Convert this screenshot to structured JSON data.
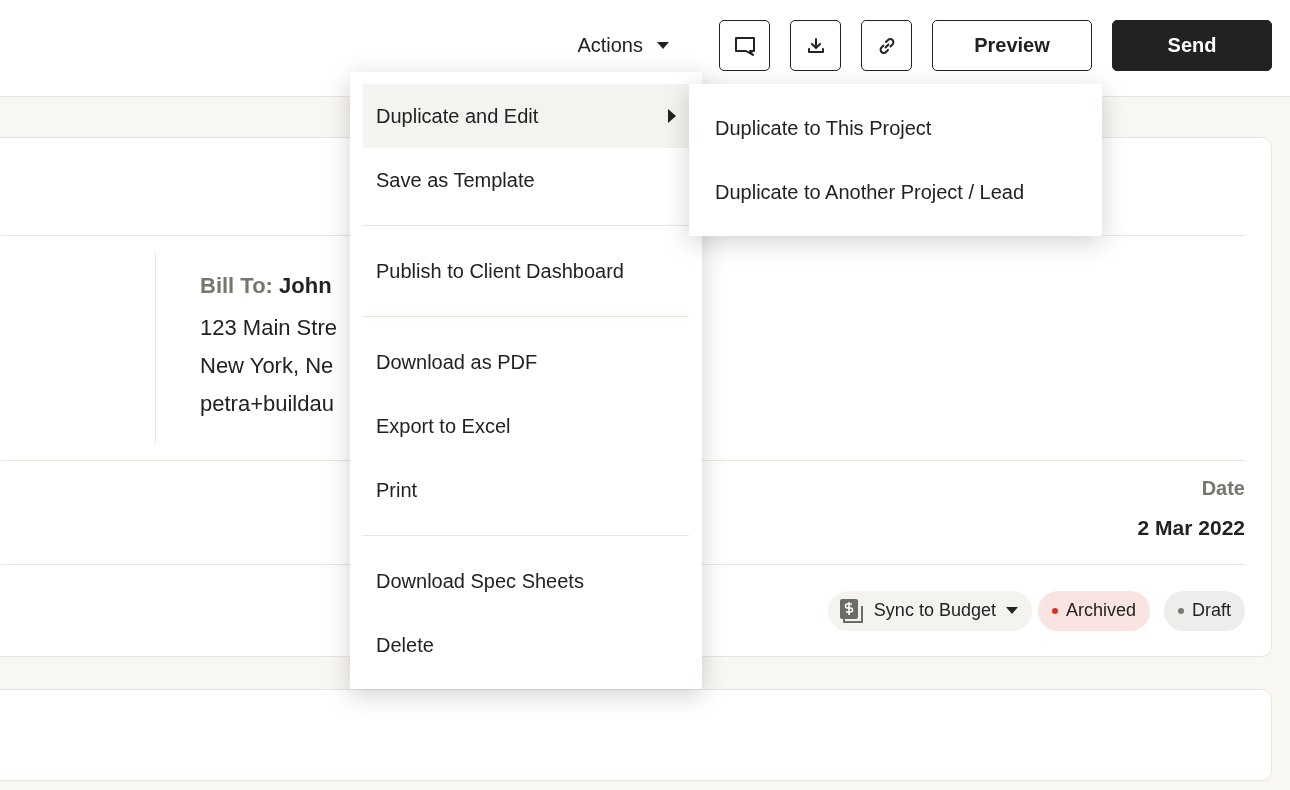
{
  "toolbar": {
    "actions_label": "Actions",
    "buttons": [
      {
        "kind": "outline",
        "label": "Preview"
      },
      {
        "kind": "primary",
        "label": "Send"
      }
    ]
  },
  "bill_to": {
    "label": "Bill To:",
    "name": "John",
    "lines": [
      "123 Main Stre",
      "New York, Ne",
      "petra+buildau"
    ]
  },
  "date": {
    "label": "Date",
    "value": "2 Mar 2022"
  },
  "sync": {
    "label": "Sync to Budget"
  },
  "statuses": [
    {
      "label": "Archived",
      "color": "#d9321f"
    },
    {
      "label": "Draft",
      "color": "#7a7a72"
    }
  ],
  "actions_menu": {
    "groups": [
      [
        {
          "label": "Duplicate and Edit",
          "selected": true,
          "has_submenu": true
        },
        {
          "label": "Save as Template",
          "selected": false,
          "has_submenu": false
        }
      ],
      [
        {
          "label": "Publish to Client Dashboard",
          "selected": false,
          "has_submenu": false
        }
      ],
      [
        {
          "label": "Download as PDF",
          "selected": false,
          "has_submenu": false
        },
        {
          "label": "Export to Excel",
          "selected": false,
          "has_submenu": false
        },
        {
          "label": "Print",
          "selected": false,
          "has_submenu": false
        }
      ],
      [
        {
          "label": "Download Spec Sheets",
          "selected": false,
          "has_submenu": false
        },
        {
          "label": "Delete",
          "selected": false,
          "has_submenu": false
        }
      ]
    ],
    "submenu": [
      "Duplicate to This Project",
      "Duplicate to Another Project / Lead"
    ]
  }
}
